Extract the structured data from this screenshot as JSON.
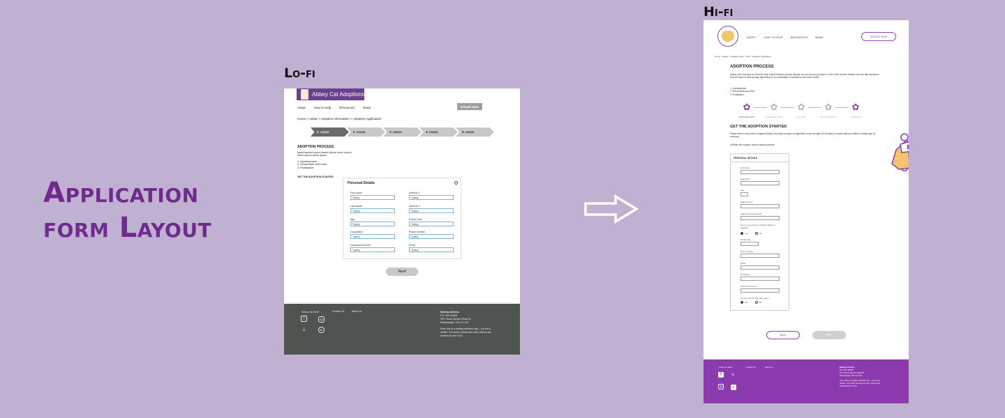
{
  "title": "Application form Layout",
  "lofi_label": "Lo-fi",
  "hifi_label": "Hi-fi",
  "colors": {
    "background": "#c0b0d2",
    "accent": "#6e2b8c",
    "lofi_footer": "#4e5450",
    "hifi_footer": "#8b3bad"
  },
  "lofi": {
    "logo_text": "Abbey Cat Adoptions",
    "nav": [
      "Adopt",
      "How to Help",
      "Resources",
      "News"
    ],
    "donate": "Donate Now",
    "breadcrumb": "Home > Adopt > Adoption information > Adoption Application",
    "steps": [
      "1. xxxxx",
      "2. xxxxx",
      "3. xxxxx",
      "4. xxxxx",
      "5. xxxxx"
    ],
    "heading": "ADOPTION PROCESS",
    "lorem": "lasdo lauxme ipsum lasem ipsum lorem ipsum lorem ipsum lorem ipsum",
    "list": [
      "1. Questionnaire",
      "2. Virtual Meet and Greet",
      "3. Finalisation"
    ],
    "started": "GET THE ADOPTION STARTED",
    "card_title": "Personal Details",
    "fields_left": [
      {
        "label": "First name",
        "value": "Typing"
      },
      {
        "label": "Last Name",
        "value": "Typing"
      },
      {
        "label": "Age",
        "value": "Typing"
      },
      {
        "label": "Occupation",
        "value": "Typing"
      },
      {
        "label": "Household income",
        "value": "Typing"
      }
    ],
    "fields_right": [
      {
        "label": "Address 1",
        "value": "Typing"
      },
      {
        "label": "Address 2",
        "value": "Typing"
      },
      {
        "label": "Postal Code",
        "value": "Typing"
      },
      {
        "label": "Phone number",
        "value": "Typing"
      },
      {
        "label": "Email",
        "value": "Typing"
      }
    ],
    "next": "Next",
    "footer": {
      "follow": "Follow Us Here!",
      "contact": "Contact Us",
      "about": "About Us",
      "address_title": "Mailing Address",
      "address_lines": [
        "P.O. Box 20025",
        "1571 North Service Road W.",
        "Mississauga, ON L4Y 3A1"
      ],
      "note": "Note: this is a mailing address only – it is not a shelter. Our foster homes and cats / kittens are located all over GTA."
    }
  },
  "hifi": {
    "nav": [
      "ADOPT",
      "HOW TO HELP",
      "RESOURCES",
      "NEWS"
    ],
    "donate": "DONATE NOW",
    "breadcrumb": "Home > Adopt > Available Cats > Pina > Adoption application",
    "heading": "ADOPTION PROCESS",
    "intro": "Abbey Cats' first goal is to find the best match between cat and adopter. As soon as you process it, to the tenth of other shelters and can take anywhere from 20 hours to several days depending on the availability of volunteers and foster homes.",
    "list": [
      "1. Questionnaire",
      "2. Virtual Meet and Greet",
      "3. Finalisation"
    ],
    "steps": [
      "PERSONAL INFO",
      "HOUSEHOLD INFO",
      "VET INFO",
      "PET OWNERSHIP",
      "COMPLETE"
    ],
    "heading2": "GET THE ADOPTION STARTED",
    "started_text": "Please bear in mind that it is against Abbey Cat policy to adopt a single kitten under the age of 6 months to a home without a kitten or similar age for company.",
    "required": "All fields are required unless marked optional.",
    "form_title": "PERSONAL DETAILS",
    "fields": [
      "First Name",
      "Last Name",
      "Age",
      "Address line 1",
      "Address line 2 (optional)"
    ],
    "permanent_q": "Are you a permanent resident/ citizen of Canada?",
    "yes": "Yes",
    "no": "No",
    "fields2": [
      "Postal code",
      "Phone number",
      "Email",
      "Occupation",
      "Household income"
    ],
    "pets_q": "Do you currently have any pets ?",
    "back": "BACK",
    "next": "NEXT",
    "footer": {
      "follow": "Follow us Here!",
      "contact": "Contact Us",
      "about": "About Us",
      "address_title": "Mailing Address",
      "address_lines": [
        "P.O. Box 20025",
        "1571 North Service Road W.",
        "Mississauga, ON L4Y 3A1"
      ],
      "note": "Note: this is a mailing address only – it is not a shelter. Our foster homes and cats / kittens are located all over GTA."
    }
  }
}
